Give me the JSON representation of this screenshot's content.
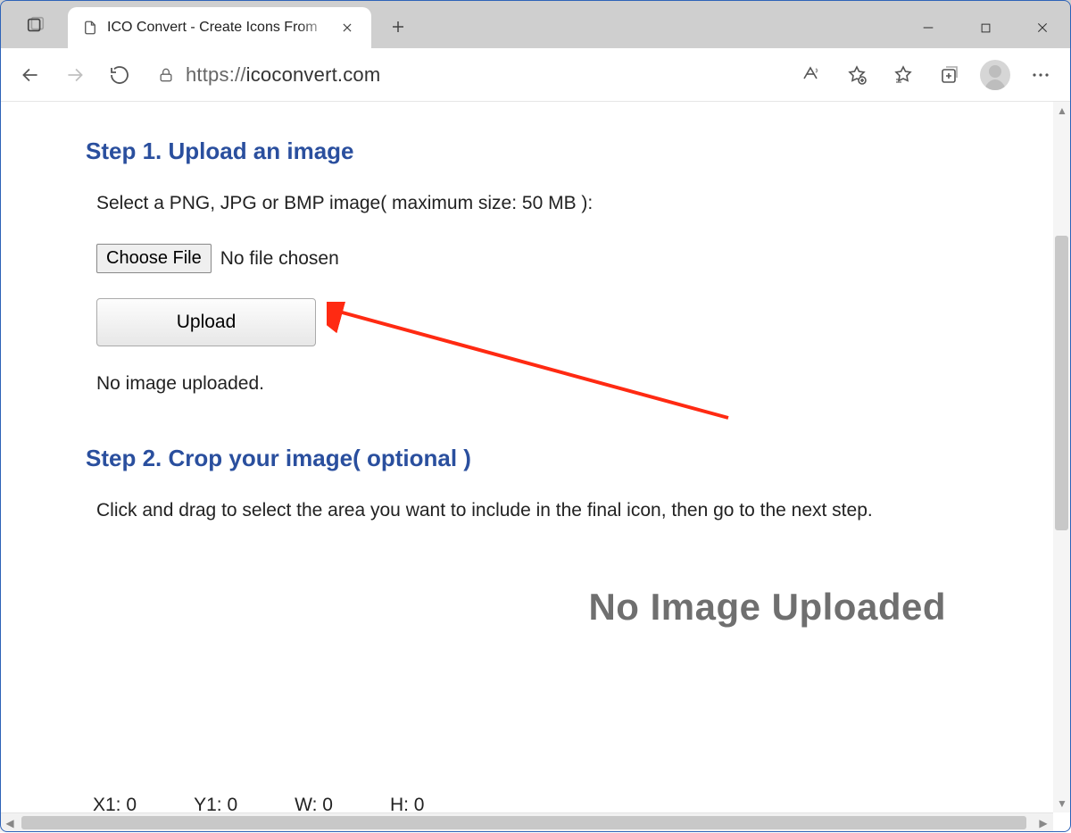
{
  "window": {
    "tab_title": "ICO Convert - Create Icons From",
    "url_prefix": "https://",
    "url_host": "icoconvert.com"
  },
  "step1": {
    "heading": "Step 1. Upload an image",
    "instruction": "Select a PNG, JPG or BMP image( maximum size: 50 MB ):",
    "choose_file_label": "Choose File",
    "no_file_label": "No file chosen",
    "upload_label": "Upload",
    "status": "No image uploaded."
  },
  "step2": {
    "heading": "Step 2. Crop your image( optional )",
    "instruction": "Click and drag to select the area you want to include in the final icon, then go to the next step."
  },
  "placeholder": "No Image Uploaded",
  "coords": {
    "x1_label": "X1:",
    "x1_val": "0",
    "y1_label": "Y1:",
    "y1_val": "0",
    "w_label": "W:",
    "w_val": "0",
    "h_label": "H:",
    "h_val": "0"
  }
}
